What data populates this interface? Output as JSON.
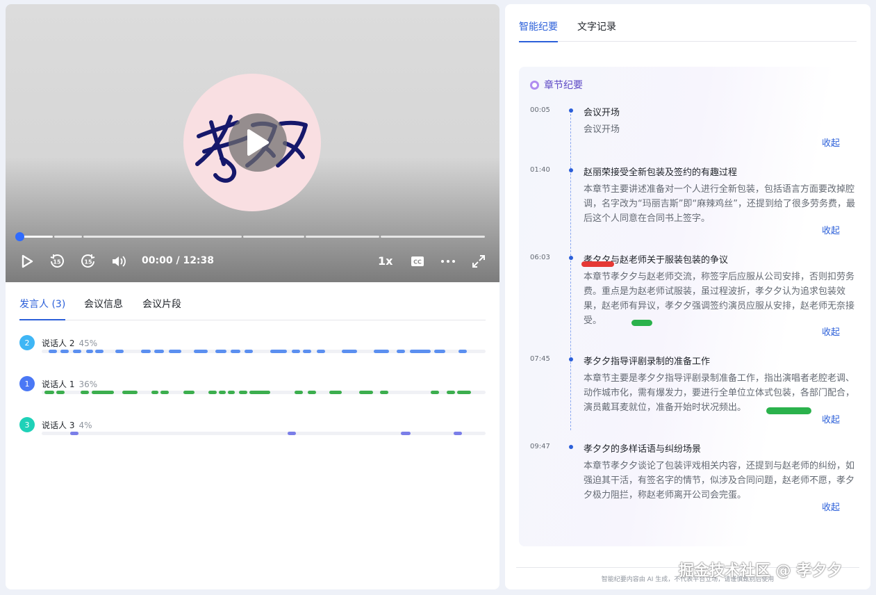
{
  "player": {
    "current_time": "00:00",
    "separator": " / ",
    "duration": "12:38",
    "speed": "1x",
    "cover_text": "孝夕夕",
    "progress": 0,
    "icons": [
      "play-icon",
      "rewind-15-icon",
      "forward-15-icon",
      "volume-icon",
      "captions-icon",
      "more-icon",
      "fullscreen-icon"
    ]
  },
  "left_tabs": [
    {
      "label": "发言人 (3)",
      "active": true
    },
    {
      "label": "会议信息",
      "active": false
    },
    {
      "label": "会议片段",
      "active": false
    }
  ],
  "speakers": [
    {
      "badge": "2",
      "name": "说话人 2",
      "pct": "45%",
      "color": "#5b8ff0",
      "badge_color": "#3fb6f5"
    },
    {
      "badge": "1",
      "name": "说话人 1",
      "pct": "36%",
      "color": "#3cae4e",
      "badge_color": "#4a78f5"
    },
    {
      "badge": "3",
      "name": "说话人 3",
      "pct": "4%",
      "color": "#7a7ee8",
      "badge_color": "#1fd1b8"
    }
  ],
  "right_tabs": [
    {
      "label": "智能纪要",
      "active": true
    },
    {
      "label": "文字记录",
      "active": false
    }
  ],
  "summary": {
    "heading": "章节纪要",
    "chapters": [
      {
        "time": "00:05",
        "title": "会议开场",
        "desc": "会议开场",
        "collapse": "收起"
      },
      {
        "time": "01:40",
        "title": "赵丽荣接受全新包装及签约的有趣过程",
        "desc": "本章节主要讲述准备对一个人进行全新包装，包括语言方面要改掉腔调，名字改为“玛丽吉斯”即“麻辣鸡丝”，还提到给了很多劳务费，最后这个人同意在合同书上签字。",
        "collapse": "收起"
      },
      {
        "time": "06:03",
        "title": "孝夕夕与赵老师关于服装包装的争议",
        "desc": "本章节孝夕夕与赵老师交流，称签字后应服从公司安排，否则扣劳务费。重点是为赵老师试服装，虽过程波折，孝夕夕认为追求包装效果，赵老师有异议，孝夕夕强调签约演员应服从安排，赵老师无奈接受。",
        "collapse": "收起"
      },
      {
        "time": "07:45",
        "title": "孝夕夕指导评剧录制的准备工作",
        "desc": "本章节主要是孝夕夕指导评剧录制准备工作，指出演唱者老腔老调、动作城市化，需有爆发力，要进行全单位立体式包装，各部门配合，演员戴耳麦就位，准备开始时状况频出。",
        "collapse": "收起"
      },
      {
        "time": "09:47",
        "title": "孝夕夕的多样话语与纠纷场景",
        "desc": "本章节孝夕夕谈论了包装评戏相关内容，还提到与赵老师的纠纷，如强迫其干活，有签名字的情节，似涉及合同问题，赵老师不愿，孝夕夕极力阻拦，称赵老师离开公司会完蛋。",
        "collapse": "收起"
      }
    ]
  },
  "footer_note": "智能纪要内容由 AI 生成，不代表平台立场，请谨慎甄别后使用",
  "watermark": "掘金技术社区 @ 孝夕夕",
  "colors": {
    "accent": "#2b5fd9",
    "highlight_red": "#e53935",
    "highlight_green": "#2bb24c"
  }
}
